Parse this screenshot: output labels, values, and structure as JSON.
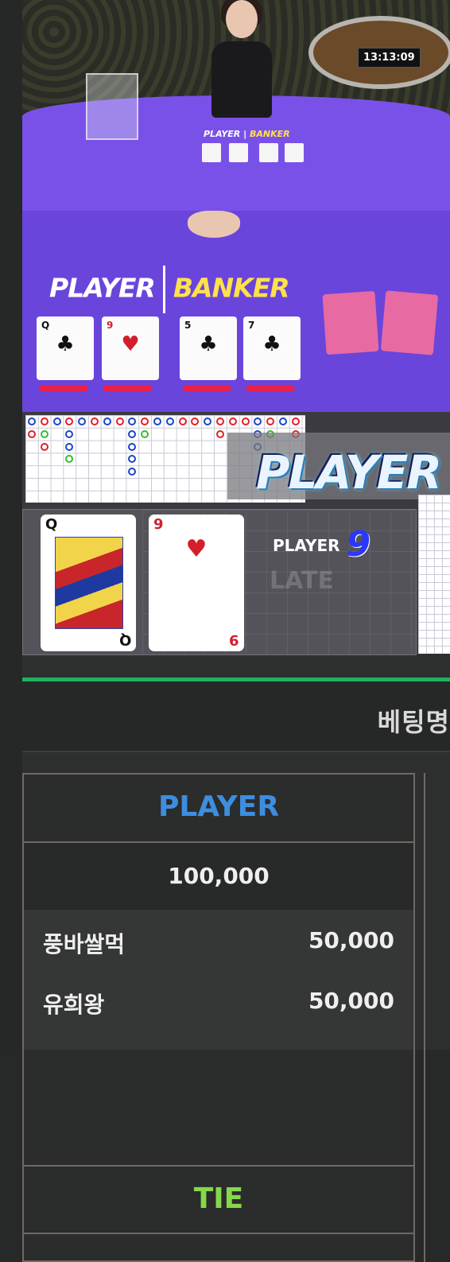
{
  "stream": {
    "clock": "13:13:09",
    "table_label_player": "PLAYER",
    "table_label_banker": "BANKER",
    "table_cards": [
      {
        "rank": "Q",
        "suit": "♣"
      },
      {
        "rank": "9",
        "suit": "♥"
      },
      {
        "rank": "5",
        "suit": "♣"
      },
      {
        "rank": "7",
        "suit": "♣"
      }
    ]
  },
  "roadmap": {
    "overlay_text": "PLAYER",
    "result_label": "PLAYER",
    "result_value": "9",
    "watermark": "LATE",
    "result_cards": [
      {
        "rank": "Q",
        "suit": "♣",
        "color": "#111111"
      },
      {
        "rank": "9",
        "suit": "♥",
        "color": "#d21f2b"
      }
    ],
    "bead_colors": {
      "banker": "#e0202a",
      "player": "#1c44c8",
      "tie": "#2fbf2f"
    }
  },
  "betting": {
    "header": "베팅명",
    "player": {
      "title": "PLAYER",
      "title_color": "#3d8ee0",
      "total": "100,000",
      "bettors": [
        {
          "name": "풍바쌀먹",
          "amount": "50,000"
        },
        {
          "name": "유희왕",
          "amount": "50,000"
        }
      ]
    },
    "tie": {
      "title": "TIE",
      "title_color": "#86d84a"
    },
    "accent": "#1fb35b"
  }
}
